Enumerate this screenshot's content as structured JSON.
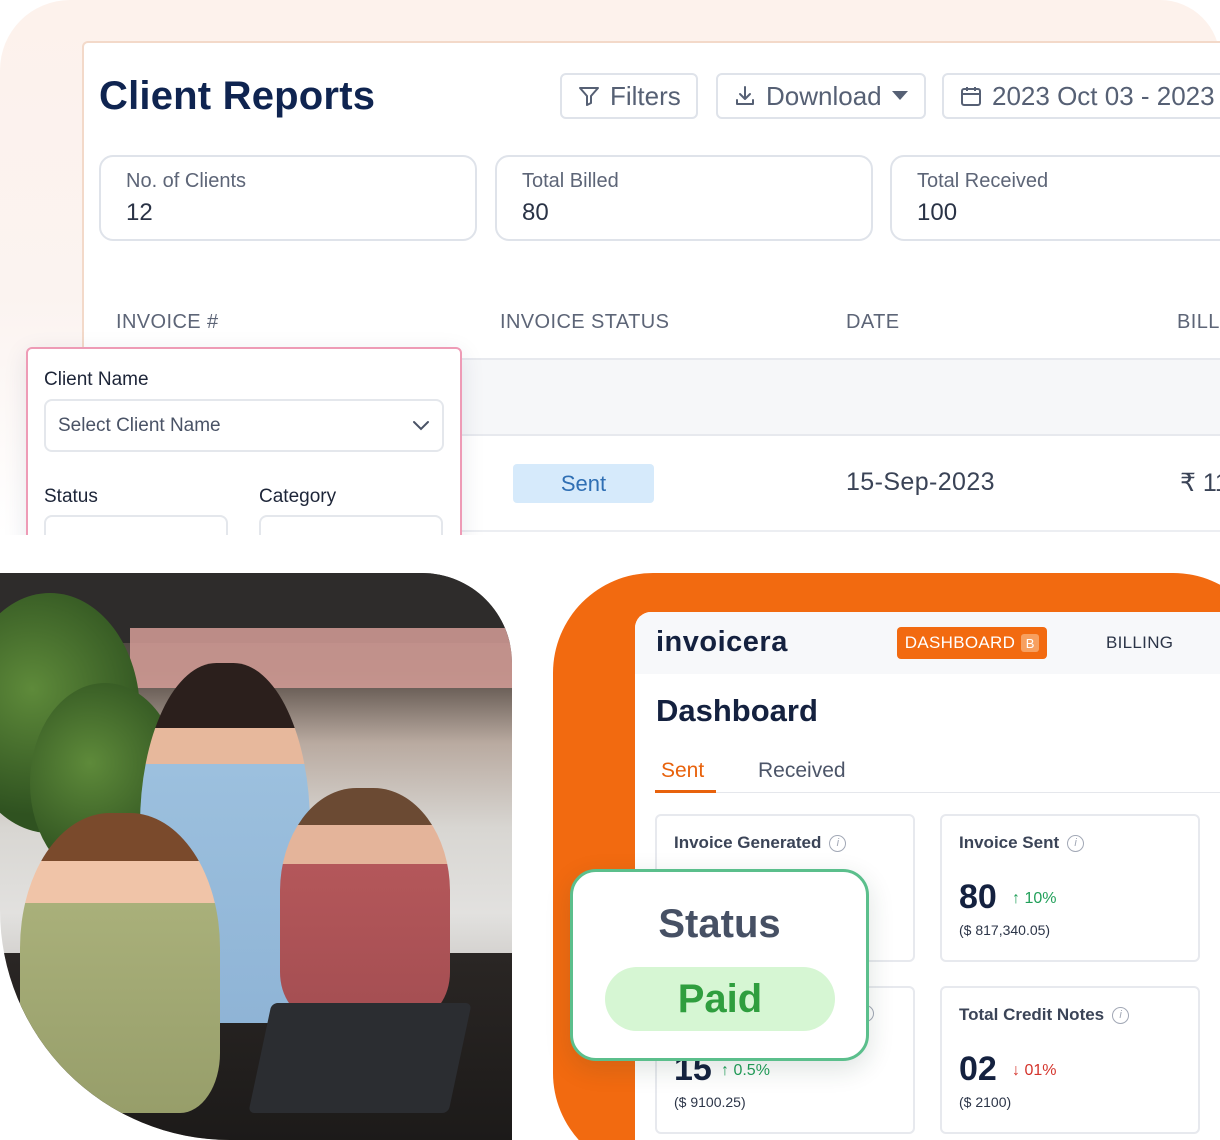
{
  "report": {
    "title": "Client Reports",
    "filters_label": "Filters",
    "download_label": "Download",
    "date_range": "2023 Oct 03 - 2023",
    "stats": [
      {
        "label": "No. of Clients",
        "value": "12"
      },
      {
        "label": "Total Billed",
        "value": "80"
      },
      {
        "label": "Total Received",
        "value": "100"
      }
    ],
    "columns": [
      "INVOICE #",
      "INVOICE STATUS",
      "DATE",
      "BILL"
    ],
    "row": {
      "status": "Sent",
      "date": "15-Sep-2023",
      "amount": "₹ 11"
    }
  },
  "filter_panel": {
    "client_label": "Client Name",
    "client_placeholder": "Select Client Name",
    "status_label": "Status",
    "category_label": "Category"
  },
  "dashboard": {
    "logo": "invoicera",
    "nav_dashboard": "DASHBOARD",
    "nav_badge": "B",
    "nav_billing": "BILLING",
    "title": "Dashboard",
    "tabs": [
      {
        "label": "Sent",
        "active": true
      },
      {
        "label": "Received",
        "active": false
      }
    ],
    "metrics": [
      {
        "label": "Invoice Generated",
        "value": "",
        "change": "",
        "direction": "up",
        "sub": ""
      },
      {
        "label": "Invoice Sent",
        "value": "80",
        "change": "10%",
        "direction": "up",
        "sub": "($ 817,340.05)"
      },
      {
        "label": "",
        "value": "15",
        "change": "0.5%",
        "direction": "up",
        "sub": "($ 9100.25)"
      },
      {
        "label": "Total Credit Notes",
        "value": "02",
        "change": "01%",
        "direction": "down",
        "sub": "($ 2100)"
      }
    ]
  },
  "status_card": {
    "title": "Status",
    "value": "Paid"
  },
  "colors": {
    "accent": "#f26a10",
    "paid": "#2f9e3e",
    "sent_badge": "#d6eafb",
    "panel_border": "#ee9bb6"
  },
  "icons": {
    "filters": "filter-icon",
    "download": "download-icon",
    "date": "calendar-icon",
    "select": "chevron-down-icon",
    "info": "info-icon"
  }
}
